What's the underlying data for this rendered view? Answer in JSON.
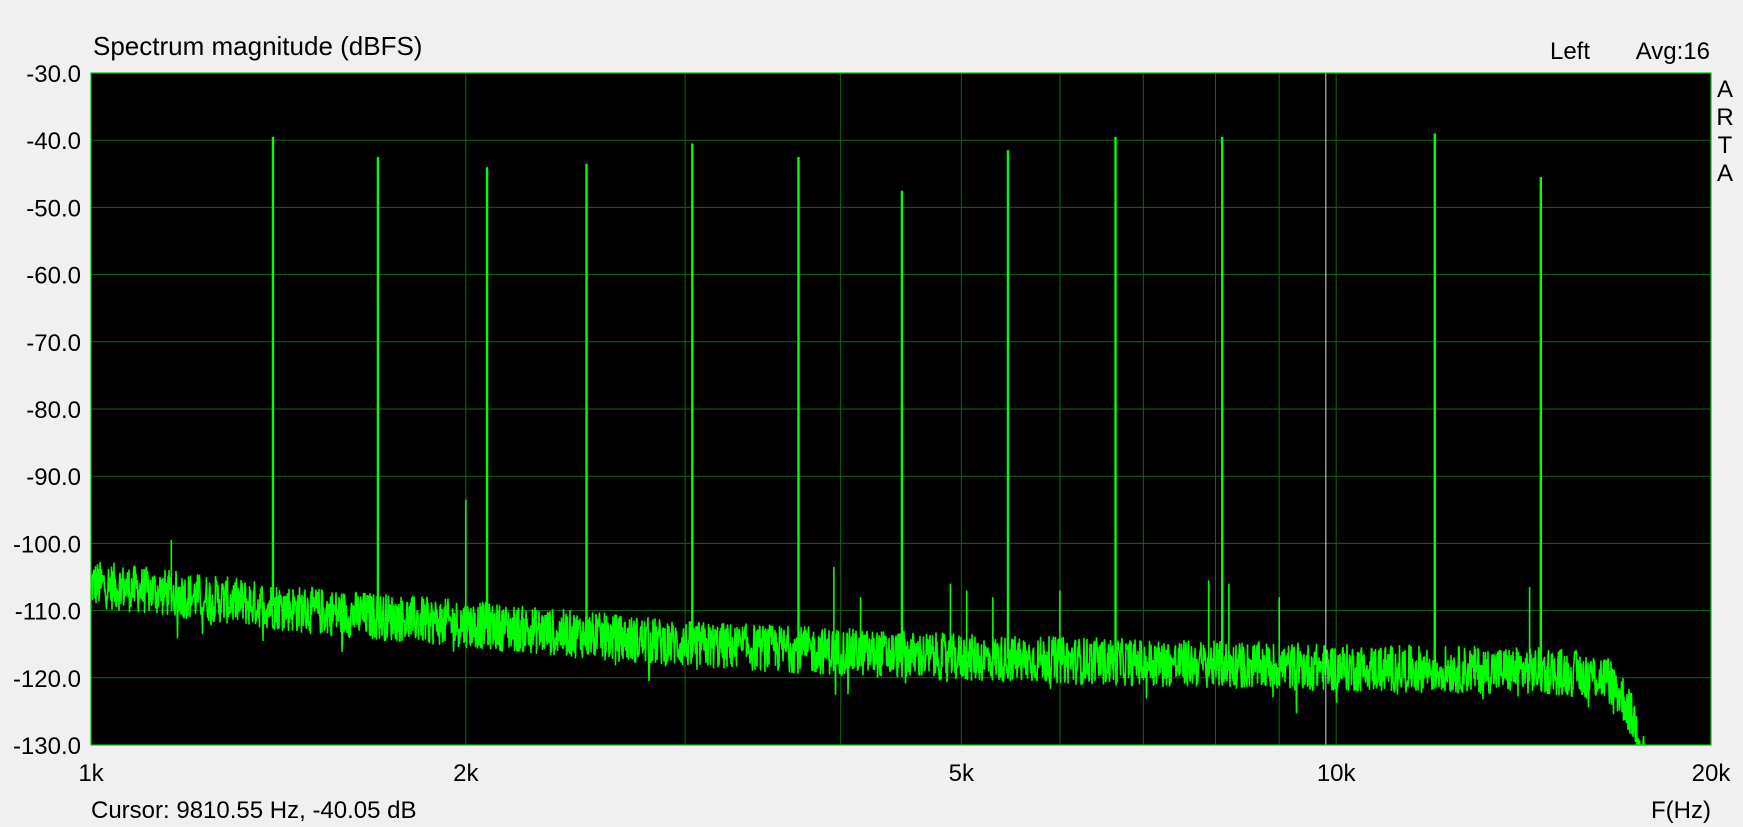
{
  "chart_data": {
    "type": "line",
    "title": "Spectrum magnitude (dBFS)",
    "channel_label": "Left",
    "average_label": "Avg:16",
    "watermark_letters": [
      "A",
      "R",
      "T",
      "A"
    ],
    "xlabel": "F(Hz)",
    "ylabel": "",
    "x_scale": "log",
    "xlim": [
      1000,
      20000
    ],
    "ylim": [
      -130,
      -30
    ],
    "grid": true,
    "x_tick_labels": [
      {
        "value": 1000,
        "label": "1k"
      },
      {
        "value": 2000,
        "label": "2k"
      },
      {
        "value": 5000,
        "label": "5k"
      },
      {
        "value": 10000,
        "label": "10k"
      },
      {
        "value": 20000,
        "label": "20k"
      }
    ],
    "x_grid_values": [
      1000,
      2000,
      3000,
      4000,
      5000,
      6000,
      7000,
      8000,
      9000,
      10000,
      20000
    ],
    "y_ticks": [
      {
        "value": -30,
        "label": "-30.0"
      },
      {
        "value": -40,
        "label": "-40.0"
      },
      {
        "value": -50,
        "label": "-50.0"
      },
      {
        "value": -60,
        "label": "-60.0"
      },
      {
        "value": -70,
        "label": "-70.0"
      },
      {
        "value": -80,
        "label": "-80.0"
      },
      {
        "value": -90,
        "label": "-90.0"
      },
      {
        "value": -100,
        "label": "-100.0"
      },
      {
        "value": -110,
        "label": "-110.0"
      },
      {
        "value": -120,
        "label": "-120.0"
      },
      {
        "value": -130,
        "label": "-130.0"
      }
    ],
    "cursor": {
      "frequency": 9810.55,
      "level": -40.05,
      "label": "Cursor: 9810.55 Hz, -40.05 dB"
    },
    "series": [
      {
        "color": "#00ff00",
        "noise_floor": [
          [
            1000,
            -106
          ],
          [
            1500,
            -110
          ],
          [
            2000,
            -112
          ],
          [
            3000,
            -115
          ],
          [
            5000,
            -117
          ],
          [
            10000,
            -118.5
          ],
          [
            15000,
            -119
          ],
          [
            16500,
            -120
          ],
          [
            17000,
            -123
          ],
          [
            17500,
            -128
          ],
          [
            17700,
            -131
          ]
        ],
        "peaks": [
          {
            "x": 1400,
            "y": -39.5
          },
          {
            "x": 1700,
            "y": -42.5
          },
          {
            "x": 2080,
            "y": -44
          },
          {
            "x": 2500,
            "y": -43.5
          },
          {
            "x": 3040,
            "y": -40.5
          },
          {
            "x": 3700,
            "y": -42.5
          },
          {
            "x": 4480,
            "y": -47.5
          },
          {
            "x": 5450,
            "y": -41.5
          },
          {
            "x": 6650,
            "y": -39.5
          },
          {
            "x": 8100,
            "y": -39.5
          },
          {
            "x": 12000,
            "y": -39
          },
          {
            "x": 14600,
            "y": -45.5
          }
        ],
        "minor_spikes": [
          {
            "x": 1160,
            "y": -99.5
          },
          {
            "x": 2000,
            "y": -93.5
          },
          {
            "x": 3950,
            "y": -103.5
          },
          {
            "x": 4150,
            "y": -108
          },
          {
            "x": 4900,
            "y": -106
          },
          {
            "x": 5050,
            "y": -107
          },
          {
            "x": 5300,
            "y": -108
          },
          {
            "x": 6000,
            "y": -107
          },
          {
            "x": 7900,
            "y": -105.5
          },
          {
            "x": 8200,
            "y": -106
          },
          {
            "x": 9000,
            "y": -108
          },
          {
            "x": 14300,
            "y": -106.5
          }
        ]
      }
    ]
  }
}
